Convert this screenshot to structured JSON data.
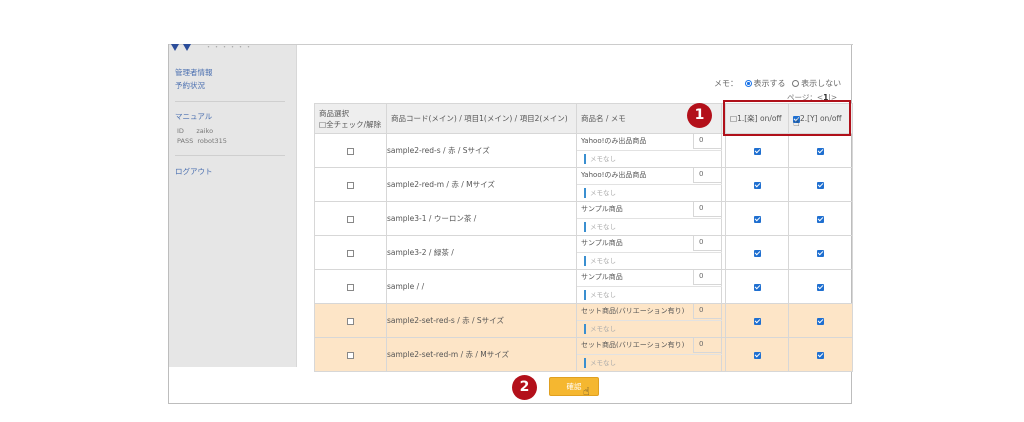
{
  "sidebar": {
    "logo_text": "・・・・・・",
    "links": [
      "管理者情報",
      "予約状況"
    ],
    "manual_label": "マニュアル",
    "id_label": "ID",
    "id_value": "zaiko",
    "pass_label": "PASS",
    "pass_value": "robot315",
    "logout_label": "ログアウト"
  },
  "memo": {
    "label": "メモ：",
    "show": "表示する",
    "hide": "表示しない"
  },
  "pagination": {
    "prefix": "ページ：<",
    "current": "1",
    "suffix": "|>"
  },
  "table": {
    "headers": {
      "select_line1": "商品選択",
      "select_line2": "□全チェック/解除",
      "code": "商品コード(メイン) / 項目1(メイン) / 項目2(メイン)",
      "name": "商品名 / メモ",
      "col1": "□1.[楽] on/off",
      "col2": "2.[Y] on/off"
    },
    "rows": [
      {
        "code": "sample2-red-s / 赤 / Sサイズ",
        "name": "Yahoo!のみ出品商品",
        "qty": "0",
        "memo": "メモなし"
      },
      {
        "code": "sample2-red-m / 赤 / Mサイズ",
        "name": "Yahoo!のみ出品商品",
        "qty": "0",
        "memo": "メモなし"
      },
      {
        "code": "sample3-1 / ウーロン茶 /",
        "name": "サンプル商品",
        "qty": "0",
        "memo": "メモなし"
      },
      {
        "code": "sample3-2 / 緑茶 /",
        "name": "サンプル商品",
        "qty": "0",
        "memo": "メモなし"
      },
      {
        "code": "sample / /",
        "name": "サンプル商品",
        "qty": "0",
        "memo": "メモなし"
      },
      {
        "code": "sample2-set-red-s / 赤 / Sサイズ",
        "name": "セット商品(バリエーション有り)",
        "qty": "0",
        "memo": "メモなし"
      },
      {
        "code": "sample2-set-red-m / 赤 / Mサイズ",
        "name": "セット商品(バリエーション有り)",
        "qty": "0",
        "memo": "メモなし"
      }
    ]
  },
  "confirm_label": "確認",
  "badges": [
    "1",
    "2"
  ],
  "colors": {
    "accent": "#f5b730",
    "highlight": "#b0101a",
    "checkbox": "#1f6fd0",
    "alt_row": "#fde5c7"
  }
}
